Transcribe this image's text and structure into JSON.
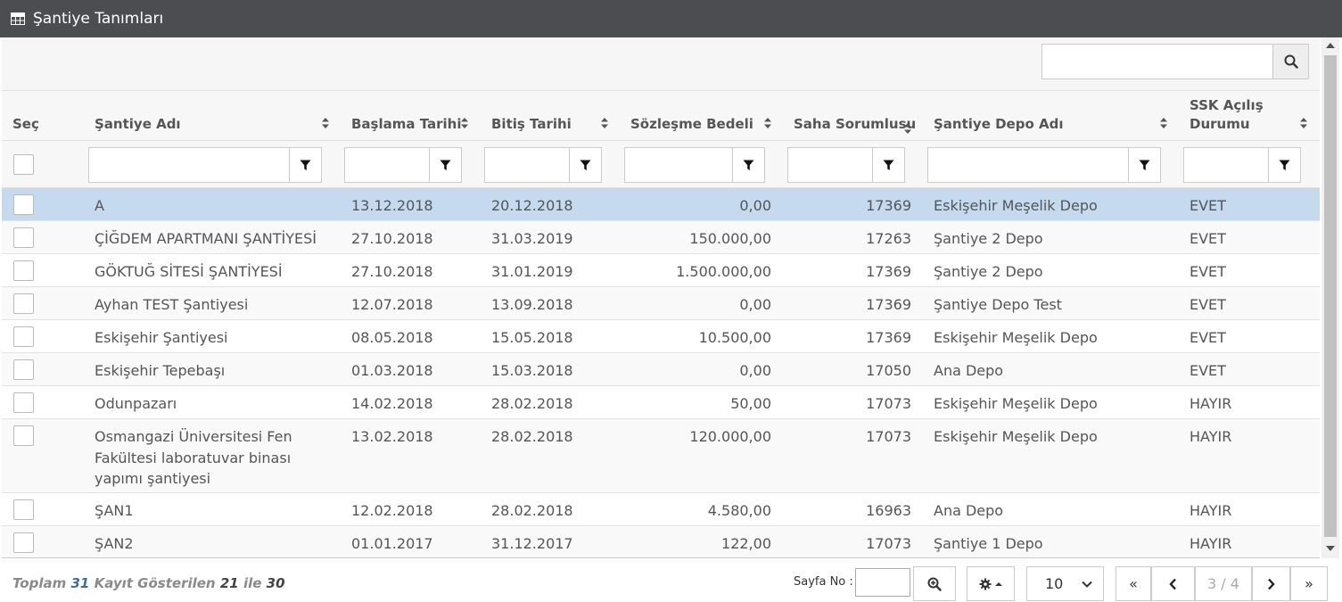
{
  "window": {
    "title": "Şantiye Tanımları",
    "icon": "table-icon"
  },
  "search": {
    "value": "",
    "placeholder": ""
  },
  "columns": [
    {
      "key": "sec",
      "label": "Seç",
      "sortable": false
    },
    {
      "key": "ad",
      "label": "Şantiye Adı",
      "sortable": true
    },
    {
      "key": "baslama",
      "label": "Başlama Tarihi",
      "sortable": true
    },
    {
      "key": "bitis",
      "label": "Bitiş Tarihi",
      "sortable": true
    },
    {
      "key": "bedel",
      "label": "Sözleşme Bedeli",
      "sortable": true
    },
    {
      "key": "sorumlu",
      "label": "Saha Sorumlusu",
      "sortable": true
    },
    {
      "key": "depo",
      "label": "Şantiye Depo Adı",
      "sortable": true
    },
    {
      "key": "ssk",
      "label": "SSK Açılış Durumu",
      "sortable": true
    }
  ],
  "filters": {
    "ad": "",
    "baslama": "",
    "bitis": "",
    "bedel": "",
    "sorumlu": "",
    "depo": "",
    "ssk": ""
  },
  "rows": [
    {
      "ad": "A",
      "baslama": "13.12.2018",
      "bitis": "20.12.2018",
      "bedel": "0,00",
      "sorumlu": "17369",
      "depo": "Eskişehir Meşelik Depo",
      "ssk": "EVET",
      "selected": true
    },
    {
      "ad": "ÇİĞDEM APARTMANI ŞANTİYESİ",
      "baslama": "27.10.2018",
      "bitis": "31.03.2019",
      "bedel": "150.000,00",
      "sorumlu": "17263",
      "depo": "Şantiye 2 Depo",
      "ssk": "EVET",
      "selected": false
    },
    {
      "ad": "GÖKTUĞ SİTESİ ŞANTİYESİ",
      "baslama": "27.10.2018",
      "bitis": "31.01.2019",
      "bedel": "1.500.000,00",
      "sorumlu": "17369",
      "depo": "Şantiye 2 Depo",
      "ssk": "EVET",
      "selected": false
    },
    {
      "ad": "Ayhan TEST Şantiyesi",
      "baslama": "12.07.2018",
      "bitis": "13.09.2018",
      "bedel": "0,00",
      "sorumlu": "17369",
      "depo": "Şantiye Depo Test",
      "ssk": "EVET",
      "selected": false
    },
    {
      "ad": "Eskişehir Şantiyesi",
      "baslama": "08.05.2018",
      "bitis": "15.05.2018",
      "bedel": "10.500,00",
      "sorumlu": "17369",
      "depo": "Eskişehir Meşelik Depo",
      "ssk": "EVET",
      "selected": false
    },
    {
      "ad": "Eskişehir Tepebaşı",
      "baslama": "01.03.2018",
      "bitis": "15.03.2018",
      "bedel": "0,00",
      "sorumlu": "17050",
      "depo": "Ana Depo",
      "ssk": "EVET",
      "selected": false
    },
    {
      "ad": "Odunpazarı",
      "baslama": "14.02.2018",
      "bitis": "28.02.2018",
      "bedel": "50,00",
      "sorumlu": "17073",
      "depo": "Eskişehir Meşelik Depo",
      "ssk": "HAYIR",
      "selected": false
    },
    {
      "ad": "Osmangazi Üniversitesi Fen Fakültesi laboratuvar binası yapımı şantiyesi",
      "baslama": "13.02.2018",
      "bitis": "28.02.2018",
      "bedel": "120.000,00",
      "sorumlu": "17073",
      "depo": "Eskişehir Meşelik Depo",
      "ssk": "HAYIR",
      "selected": false
    },
    {
      "ad": "ŞAN1",
      "baslama": "12.02.2018",
      "bitis": "28.02.2018",
      "bedel": "4.580,00",
      "sorumlu": "16963",
      "depo": "Ana Depo",
      "ssk": "HAYIR",
      "selected": false
    },
    {
      "ad": "ŞAN2",
      "baslama": "01.01.2017",
      "bitis": "31.12.2017",
      "bedel": "122,00",
      "sorumlu": "17073",
      "depo": "Şantiye 1 Depo",
      "ssk": "HAYIR",
      "selected": false
    }
  ],
  "footer": {
    "summary": {
      "prefix": "Toplam",
      "total": "31",
      "middle": "Kayıt Gösterilen",
      "from": "21",
      "sep": "ile",
      "to": "30"
    },
    "page_label": "Sayfa No :",
    "page_input": "",
    "page_size": "10",
    "page_indicator": "3 / 4",
    "first": "«",
    "last": "»"
  },
  "colors": {
    "titlebar": "#4b4d50",
    "selected_row": "#c5d9ef",
    "accent": "#3c6ea6"
  }
}
